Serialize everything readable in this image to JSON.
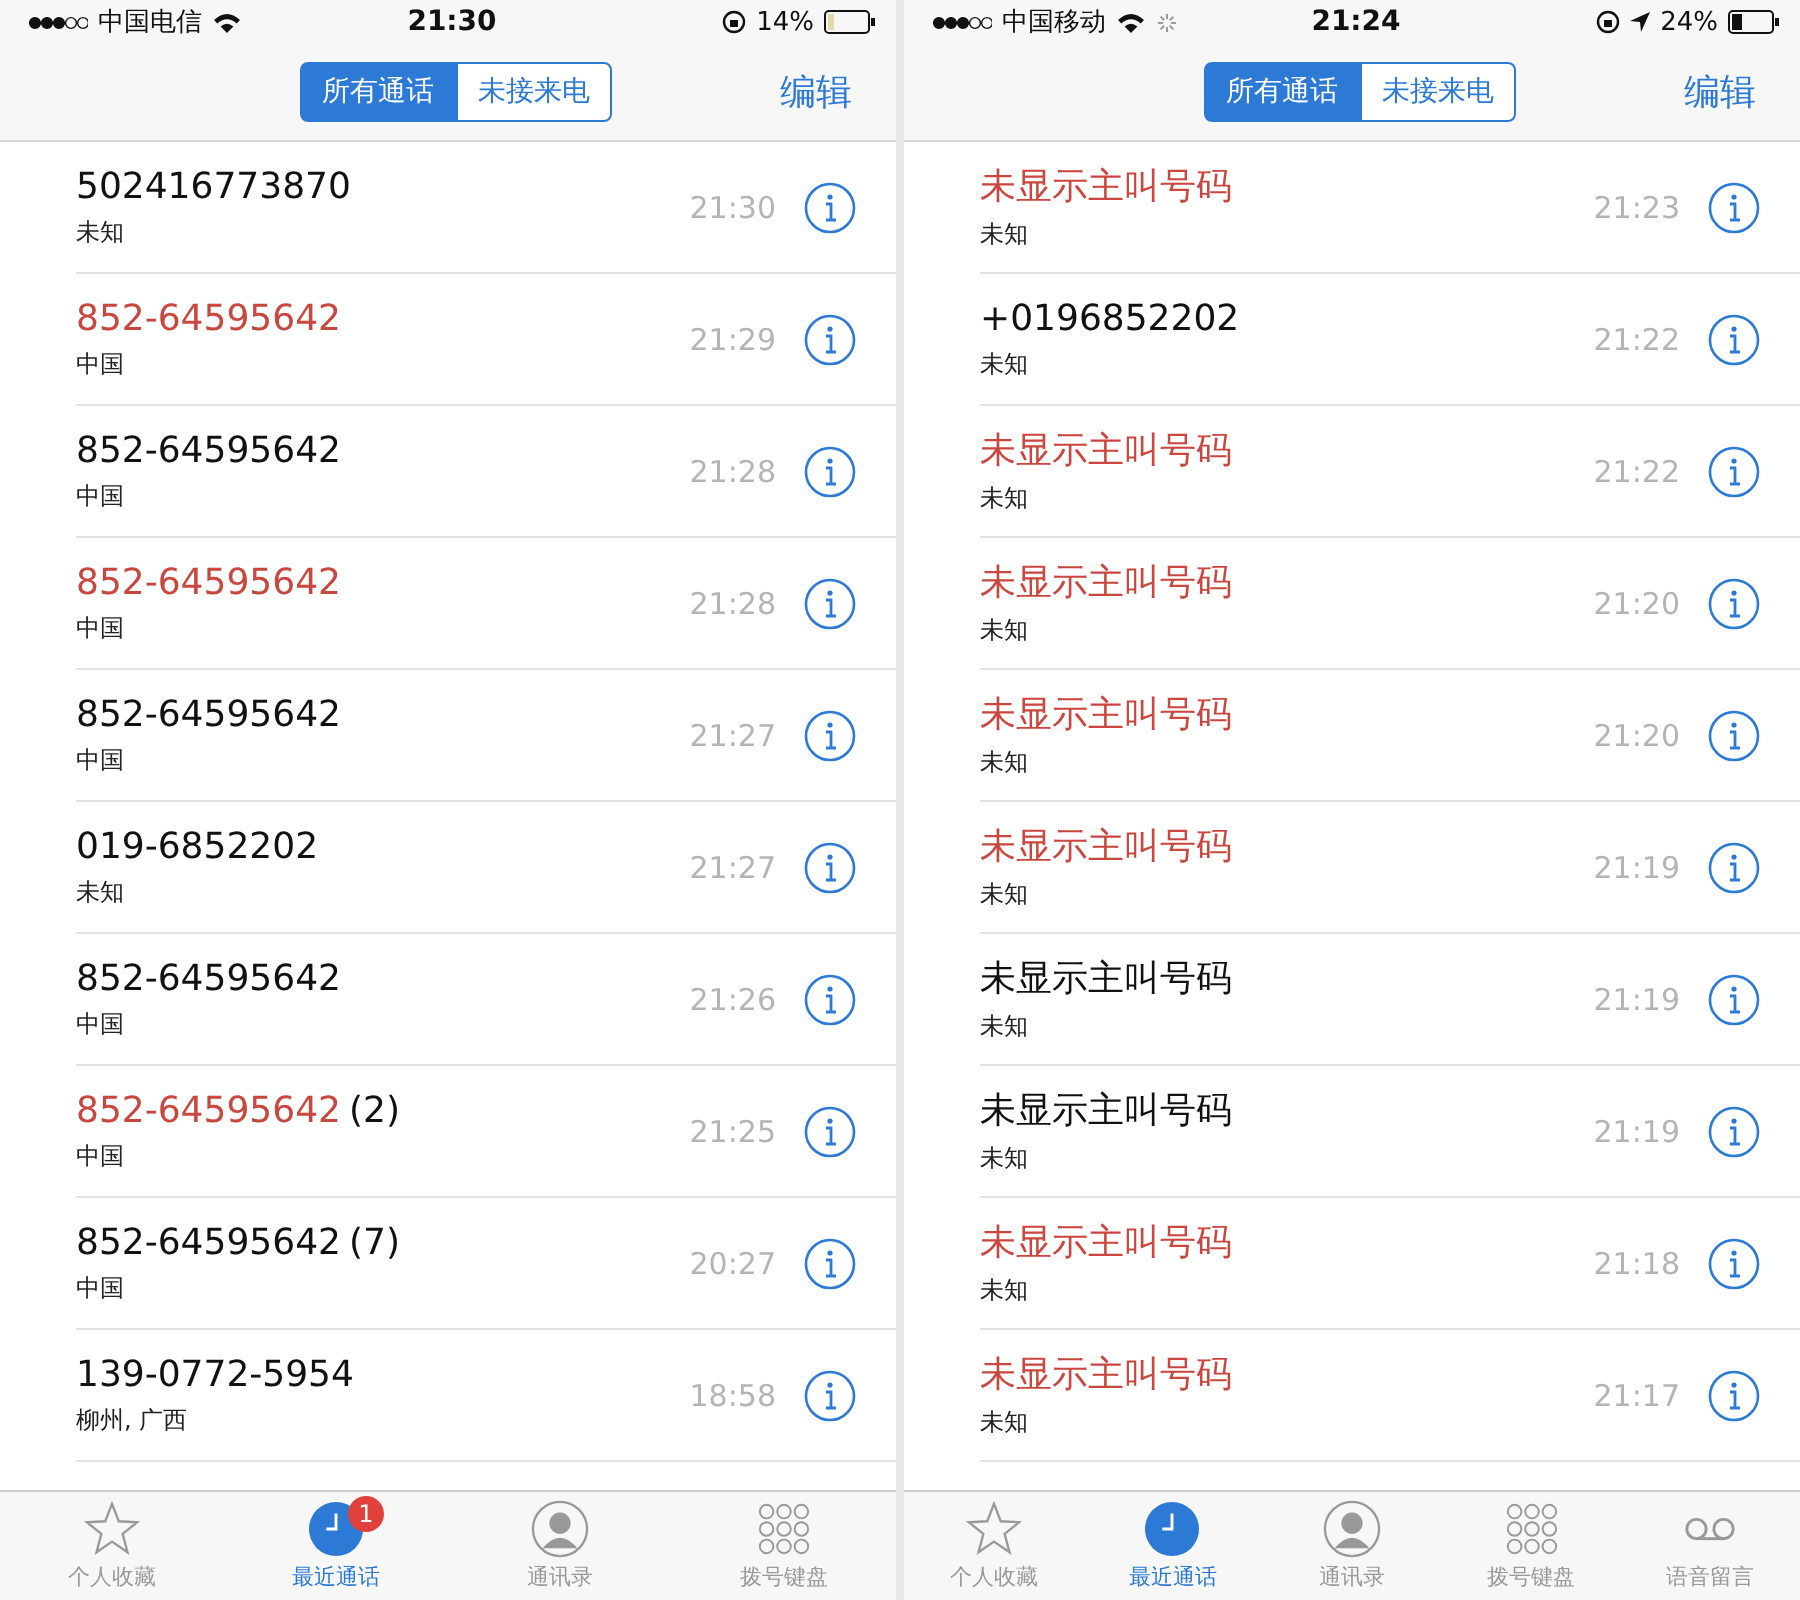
{
  "phones": [
    {
      "status_bar": {
        "carrier": "中国电信",
        "time": "21:30",
        "battery": "14%",
        "location": false,
        "loading": false
      },
      "segments": [
        {
          "label": "所有通话",
          "selected": true
        },
        {
          "label": "未接来电",
          "selected": false
        }
      ],
      "edit": "编辑",
      "calls": [
        {
          "name": "502416773870",
          "missed": false,
          "location": "未知",
          "time": "21:30"
        },
        {
          "name": "852-64595642",
          "missed": true,
          "location": "中国",
          "time": "21:29"
        },
        {
          "name": "852-64595642",
          "missed": false,
          "location": "中国",
          "time": "21:28"
        },
        {
          "name": "852-64595642",
          "missed": true,
          "location": "中国",
          "time": "21:28"
        },
        {
          "name": "852-64595642",
          "missed": false,
          "location": "中国",
          "time": "21:27"
        },
        {
          "name": "019-6852202",
          "missed": false,
          "location": "未知",
          "time": "21:27"
        },
        {
          "name": "852-64595642",
          "missed": false,
          "location": "中国",
          "time": "21:26"
        },
        {
          "name": "852-64595642",
          "count": "(2)",
          "missed": true,
          "location": "中国",
          "time": "21:25"
        },
        {
          "name": "852-64595642",
          "count": "(7)",
          "missed": false,
          "location": "中国",
          "time": "20:27"
        },
        {
          "name": "139-0772-5954",
          "missed": false,
          "location": "柳州, 广西",
          "time": "18:58"
        }
      ],
      "tabs": [
        {
          "kind": "star",
          "label": "个人收藏",
          "selected": false
        },
        {
          "kind": "clock",
          "label": "最近通话",
          "selected": true,
          "badge": "1"
        },
        {
          "kind": "person",
          "label": "通讯录",
          "selected": false
        },
        {
          "kind": "keypad",
          "label": "拨号键盘",
          "selected": false
        }
      ]
    },
    {
      "status_bar": {
        "carrier": "中国移动",
        "time": "21:24",
        "battery": "24%",
        "location": true,
        "loading": true
      },
      "segments": [
        {
          "label": "所有通话",
          "selected": true
        },
        {
          "label": "未接来电",
          "selected": false
        }
      ],
      "edit": "编辑",
      "calls": [
        {
          "name": "未显示主叫号码",
          "missed": true,
          "location": "未知",
          "time": "21:23"
        },
        {
          "name": "+0196852202",
          "missed": false,
          "location": "未知",
          "time": "21:22"
        },
        {
          "name": "未显示主叫号码",
          "missed": true,
          "location": "未知",
          "time": "21:22"
        },
        {
          "name": "未显示主叫号码",
          "missed": true,
          "location": "未知",
          "time": "21:20"
        },
        {
          "name": "未显示主叫号码",
          "missed": true,
          "location": "未知",
          "time": "21:20"
        },
        {
          "name": "未显示主叫号码",
          "missed": true,
          "location": "未知",
          "time": "21:19"
        },
        {
          "name": "未显示主叫号码",
          "missed": false,
          "location": "未知",
          "time": "21:19"
        },
        {
          "name": "未显示主叫号码",
          "missed": false,
          "location": "未知",
          "time": "21:19"
        },
        {
          "name": "未显示主叫号码",
          "missed": true,
          "location": "未知",
          "time": "21:18"
        },
        {
          "name": "未显示主叫号码",
          "missed": true,
          "location": "未知",
          "time": "21:17"
        }
      ],
      "tabs": [
        {
          "kind": "star",
          "label": "个人收藏",
          "selected": false
        },
        {
          "kind": "clock",
          "label": "最近通话",
          "selected": true
        },
        {
          "kind": "person",
          "label": "通讯录",
          "selected": false
        },
        {
          "kind": "keypad",
          "label": "拨号键盘",
          "selected": false
        },
        {
          "kind": "voicemail",
          "label": "语音留言",
          "selected": false
        }
      ]
    }
  ]
}
